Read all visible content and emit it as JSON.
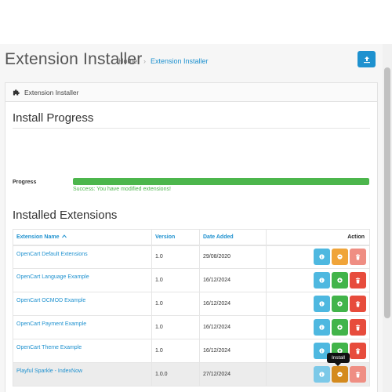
{
  "header": {
    "title": "Extension Installer",
    "breadcrumb": {
      "home": "Home",
      "current": "Extension Installer"
    },
    "upload_icon": "upload-icon"
  },
  "panel": {
    "heading": "Extension Installer",
    "heading_icon": "puzzle-icon"
  },
  "install_progress": {
    "title": "Install Progress",
    "label": "Progress",
    "percent": 100,
    "message": "Success: You have modified extensions!",
    "color": "#4cb64c"
  },
  "installed": {
    "title": "Installed Extensions",
    "columns": {
      "name": "Extension Name",
      "version": "Version",
      "date": "Date Added",
      "action": "Action"
    },
    "rows": [
      {
        "name": "OpenCart Default Extensions",
        "version": "1.0",
        "date": "29/08/2020"
      },
      {
        "name": "OpenCart Language Example",
        "version": "1.0",
        "date": "16/12/2024"
      },
      {
        "name": "OpenCart OCMOD Example",
        "version": "1.0",
        "date": "16/12/2024"
      },
      {
        "name": "OpenCart Payment Example",
        "version": "1.0",
        "date": "16/12/2024"
      },
      {
        "name": "OpenCart Theme Example",
        "version": "1.0",
        "date": "16/12/2024"
      },
      {
        "name": "Playful Sparkle - IndexNow",
        "version": "1.0.0",
        "date": "27/12/2024"
      }
    ]
  },
  "tooltip": {
    "text": "Install"
  },
  "colors": {
    "primary": "#1e91cf",
    "info": "#4eb8e0",
    "warning": "#f0a439",
    "success": "#42b44a",
    "danger": "#e74c3c"
  }
}
